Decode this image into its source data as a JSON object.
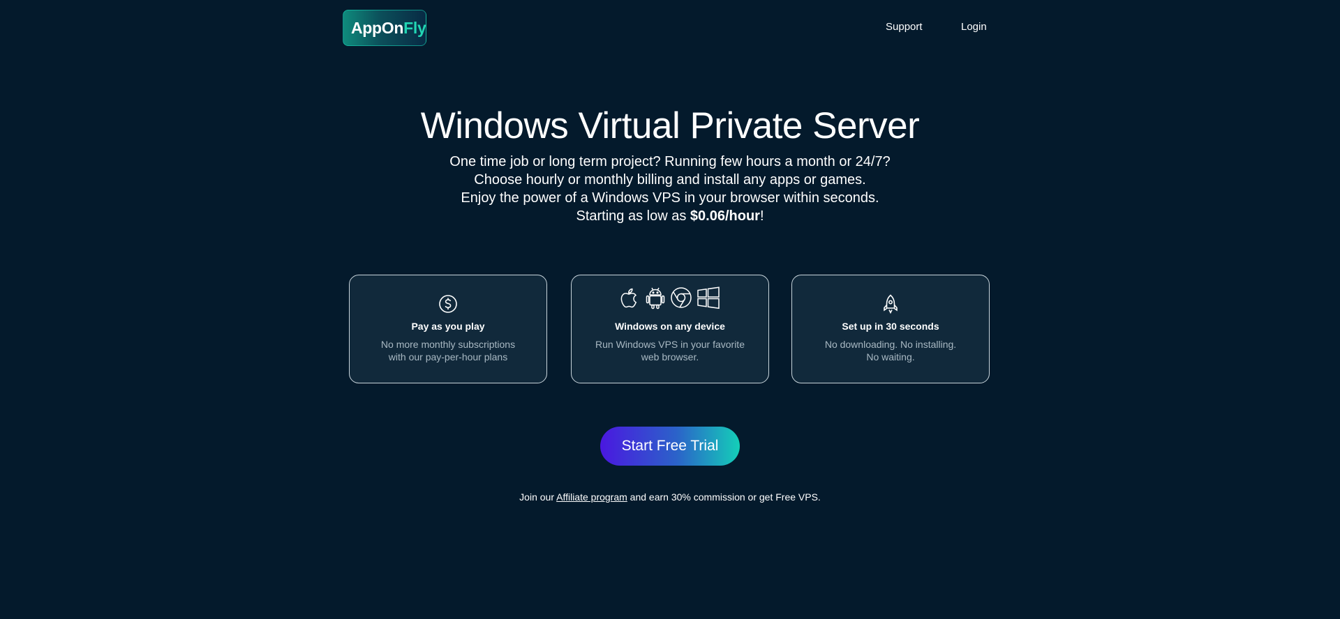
{
  "header": {
    "logo_part1": "AppOn",
    "logo_part2": "Fly",
    "nav_support": "Support",
    "nav_login": "Login"
  },
  "hero": {
    "title": "Windows Virtual Private Server",
    "line1": "One time job or long term project? Running few hours a month or 24/7?",
    "line2": "Choose hourly or monthly billing and install any apps or games.",
    "line3": "Enjoy the power of a Windows VPS in your browser within seconds.",
    "line4_prefix": "Starting as low as ",
    "line4_price": "$0.06/hour",
    "line4_suffix": "!"
  },
  "features": [
    {
      "icon": "dollar-circle-icon",
      "title": "Pay as you play",
      "desc_line1": "No more monthly subscriptions",
      "desc_line2": "with our pay-per-hour plans"
    },
    {
      "icons": [
        "apple-icon",
        "android-icon",
        "chrome-icon",
        "windows-icon"
      ],
      "title": "Windows on any device",
      "desc_line1": "Run Windows VPS in your favorite",
      "desc_line2": "web browser."
    },
    {
      "icon": "rocket-icon",
      "title": "Set up in 30 seconds",
      "desc_line1": "No downloading. No installing.",
      "desc_line2": "No waiting."
    }
  ],
  "cta": {
    "label": "Start Free Trial"
  },
  "affiliate": {
    "prefix": "Join our ",
    "link": "Affiliate program",
    "suffix": " and earn 30% commission or get Free VPS."
  },
  "colors": {
    "background": "#041a2c",
    "card_background": "#11293b",
    "accent_teal": "#22d6b4",
    "accent_purple": "#4a18e0"
  }
}
